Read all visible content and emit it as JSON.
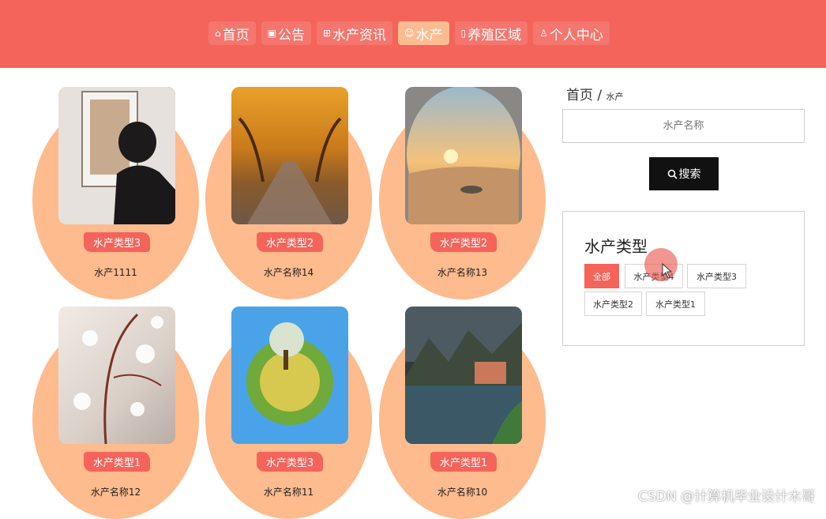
{
  "nav": [
    {
      "icon": "home-icon",
      "glyph": "⌂",
      "label": "首页"
    },
    {
      "icon": "gift-icon",
      "glyph": "▣",
      "label": "公告"
    },
    {
      "icon": "grid-icon",
      "glyph": "⊞",
      "label": "水产资讯"
    },
    {
      "icon": "smile-icon",
      "glyph": "☺",
      "label": "水产",
      "active": true
    },
    {
      "icon": "columns-icon",
      "glyph": "▯",
      "label": "养殖区域"
    },
    {
      "icon": "user-icon",
      "glyph": "♙",
      "label": "个人中心"
    }
  ],
  "cards": [
    {
      "category": "水产类型3",
      "name": "水产1111"
    },
    {
      "category": "水产类型2",
      "name": "水产名称14"
    },
    {
      "category": "水产类型2",
      "name": "水产名称13"
    },
    {
      "category": "水产类型1",
      "name": "水产名称12"
    },
    {
      "category": "水产类型3",
      "name": "水产名称11"
    },
    {
      "category": "水产类型1",
      "name": "水产名称10"
    }
  ],
  "breadcrumb": {
    "home": "首页",
    "separator": "/",
    "current": "水产"
  },
  "search": {
    "placeholder": "水产名称",
    "button_icon": "search-icon",
    "button_label": "搜索"
  },
  "filter": {
    "title": "水产类型",
    "options": [
      "全部",
      "水产类型4",
      "水产类型3",
      "水产类型2",
      "水产类型1"
    ],
    "selected": "全部"
  },
  "watermark": "CSDN @计算机毕业设计木哥",
  "colors": {
    "primary": "#f4645a",
    "accent": "#fdbb8e",
    "dark": "#111111"
  }
}
